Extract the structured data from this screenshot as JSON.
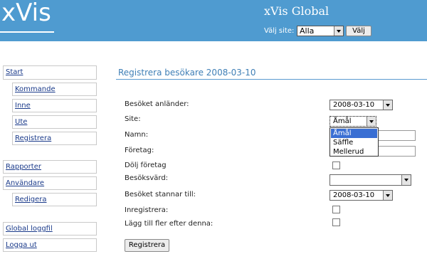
{
  "header": {
    "logo": "xVis",
    "title": "xVis Global",
    "site_label": "Välj site:",
    "site_value": "Alla",
    "site_button": "Välj"
  },
  "nav": {
    "start": "Start",
    "kommande": "Kommande",
    "inne": "Inne",
    "ute": "Ute",
    "registrera": "Registrera",
    "rapporter": "Rapporter",
    "anvandare": "Användare",
    "redigera": "Redigera",
    "global_loggfil": "Global loggfil",
    "logga_ut": "Logga ut"
  },
  "form": {
    "title": "Registrera besökare 2008-03-10",
    "arrival_label": "Besöket anländer:",
    "arrival_value": "2008-03-10",
    "site_label": "Site:",
    "site_value": "Åmål",
    "site_options": [
      "Åmål",
      "Säffle",
      "Mellerud"
    ],
    "name_label": "Namn:",
    "company_label": "Företag:",
    "hide_company_label": "Dölj företag",
    "host_label": "Besöksvärd:",
    "host_value": "",
    "stay_label": "Besöket stannar till:",
    "stay_value": "2008-03-10",
    "checkin_label": "Inregistrera:",
    "add_more_label": "Lägg till fler efter denna:",
    "submit_label": "Registrera"
  }
}
